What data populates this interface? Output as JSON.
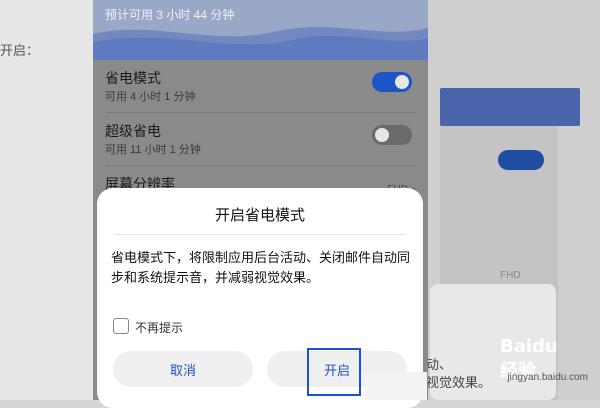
{
  "background": {
    "left_text": "开启：",
    "right_fhd": "FHD",
    "right_card_text": [
      "动、",
      "视觉效果。"
    ]
  },
  "phone": {
    "battery_estimate": "预计可用 3 小时 44 分钟",
    "items": [
      {
        "title": "省电模式",
        "subtitle": "可用 4 小时 1 分钟",
        "toggle": "on"
      },
      {
        "title": "超级省电",
        "subtitle": "可用 11 小时 1 分钟",
        "toggle": "off"
      },
      {
        "title": "屏幕分辨率",
        "value": "FHD",
        "chevron": "chevron-right-icon"
      }
    ]
  },
  "dialog": {
    "title": "开启省电模式",
    "body": "省电模式下，将限制应用后台活动、关闭邮件自动同步和系统提示音，并减弱视觉效果。",
    "checkbox_label": "不再提示",
    "checkbox_checked": false,
    "cancel_label": "取消",
    "confirm_label": "开启"
  },
  "watermark": {
    "brand": "Baidu经验",
    "domain": "jingyan.baidu.com"
  },
  "colors": {
    "accent_blue": "#1e55c6",
    "highlight_border": "#1c4fd8"
  }
}
